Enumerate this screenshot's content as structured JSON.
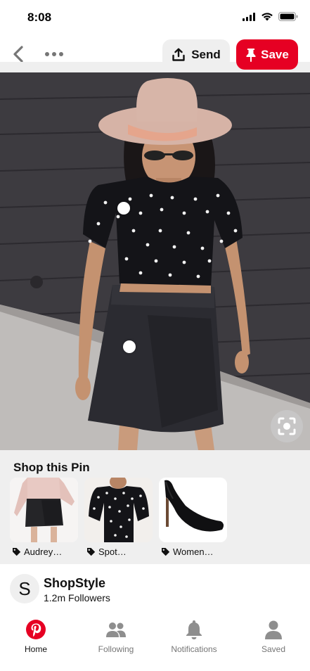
{
  "status_bar": {
    "time": "8:08"
  },
  "top_bar": {
    "send_label": "Send",
    "save_label": "Save"
  },
  "shop": {
    "title": "Shop this Pin",
    "items": [
      {
        "label": "Audrey…"
      },
      {
        "label": "Spot…"
      },
      {
        "label": "Women…"
      }
    ]
  },
  "creator": {
    "initial": "S",
    "name": "ShopStyle",
    "followers": "1.2m Followers"
  },
  "nav": {
    "items": [
      {
        "label": "Home",
        "icon": "pinterest-logo-icon",
        "active": true
      },
      {
        "label": "Following",
        "icon": "people-icon",
        "active": false
      },
      {
        "label": "Notifications",
        "icon": "bell-icon",
        "active": false
      },
      {
        "label": "Saved",
        "icon": "person-icon",
        "active": false
      }
    ]
  },
  "colors": {
    "brand_red": "#e60023",
    "light_gray": "#efefef",
    "muted_text": "#767676"
  }
}
